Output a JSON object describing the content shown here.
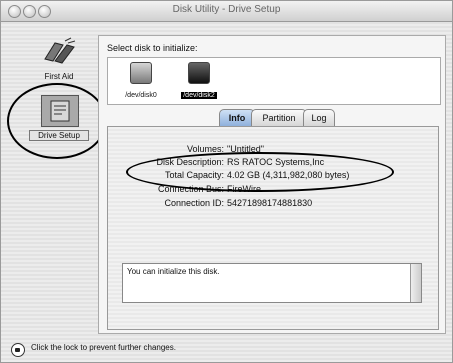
{
  "window": {
    "title": "Disk Utility - Drive Setup"
  },
  "sidebar": {
    "items": [
      {
        "label": "First Aid",
        "icon": "first-aid-icon"
      },
      {
        "label": "Drive Setup",
        "icon": "drive-setup-icon",
        "selected": true
      }
    ]
  },
  "main": {
    "prompt": "Select disk to initialize:",
    "disks": [
      {
        "label": "/dev/disk0",
        "selected": false
      },
      {
        "label": "/dev/disk2",
        "selected": true
      }
    ],
    "tabs": [
      {
        "label": "Info",
        "selected": true
      },
      {
        "label": "Partition",
        "selected": false
      },
      {
        "label": "Log",
        "selected": false
      }
    ],
    "info": [
      {
        "key": "Volumes:",
        "value": "\"Untitled\""
      },
      {
        "key": "Disk Description:",
        "value": "RS RATOC Systems,Inc"
      },
      {
        "key": "Total Capacity:",
        "value": "4.02 GB (4,311,982,080 bytes)"
      },
      {
        "key": "Connection Bus:",
        "value": "FireWire"
      },
      {
        "key": "Connection ID:",
        "value": "54271898174881830"
      }
    ],
    "status_text": "You can initialize this disk."
  },
  "footer": {
    "lock_text": "Click the lock to prevent further changes."
  }
}
